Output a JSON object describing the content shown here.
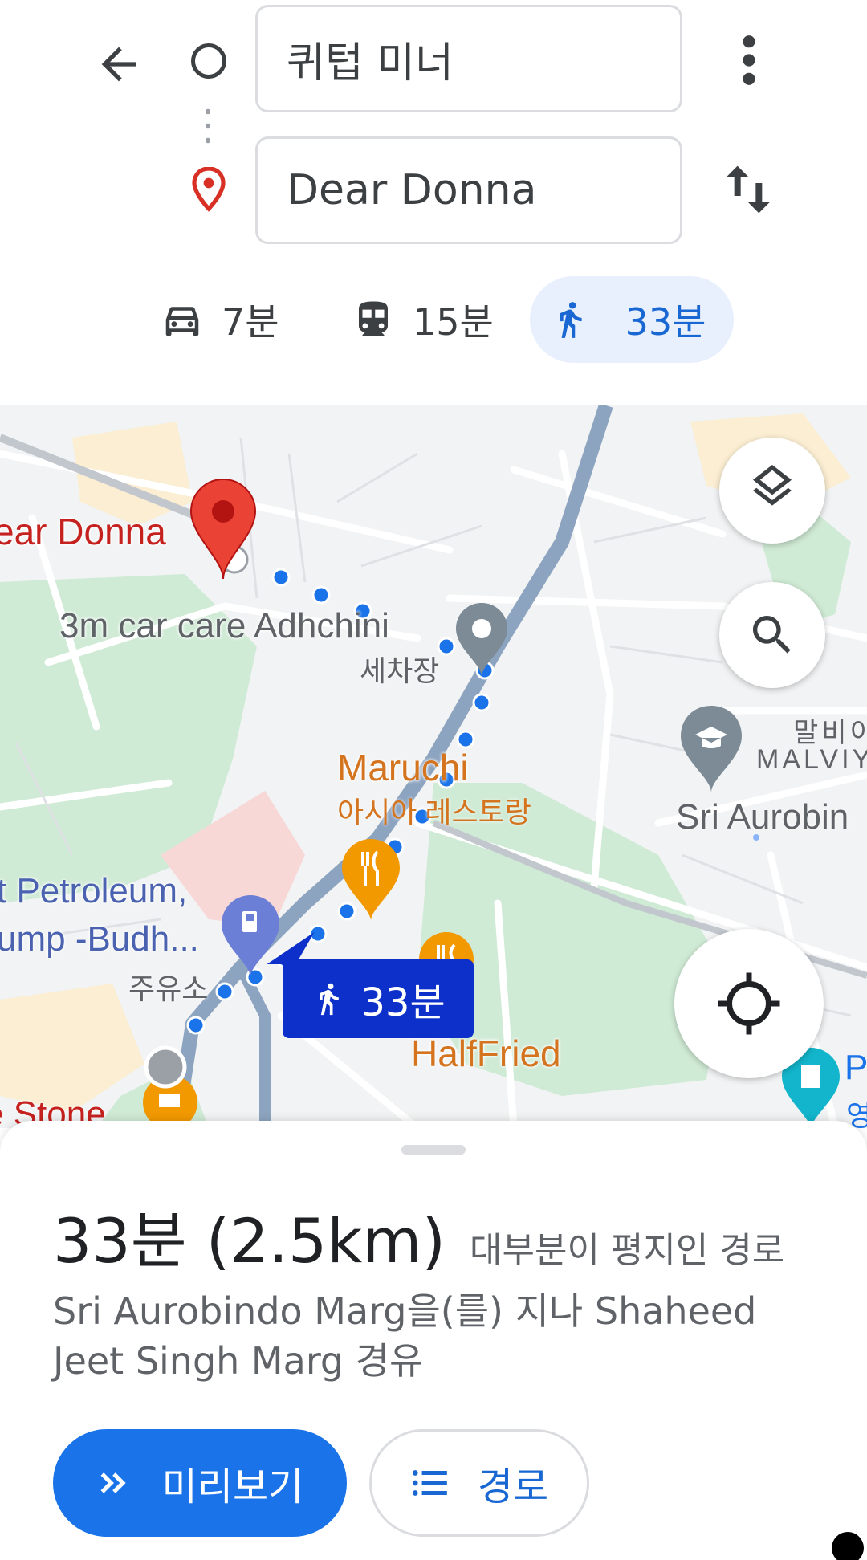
{
  "search": {
    "origin_value": "퀴텁 미너",
    "destination_value": "Dear Donna"
  },
  "modes": [
    {
      "icon": "car-icon",
      "label": "7분",
      "selected": false
    },
    {
      "icon": "train-icon",
      "label": "15분",
      "selected": false
    },
    {
      "icon": "walk-icon",
      "label": "33분",
      "selected": true
    }
  ],
  "map": {
    "labels": {
      "destination": "ear Donna",
      "carcare": "3m car care Adhchini",
      "carcare_sub": "세차장",
      "maruchi": "Maruchi",
      "maruchi_sub": "아시아 레스토랑",
      "petrol_line1": "t Petroleum,",
      "petrol_line2": "ump -Budh...",
      "petrol_sub": "주유소",
      "halffried": "HalfFried",
      "malviya1": "말비이",
      "malviya2": "MALVIY",
      "aurobindo": "Sri Aurobin",
      "stone": "e Stone",
      "p": "P",
      "p2": "영"
    },
    "route_chip": "33분",
    "route_color": "#1a73e8"
  },
  "sheet": {
    "duration": "33분 (2.5km)",
    "terrain": "대부분이 평지인 경로",
    "via": "Sri Aurobindo Marg을(를) 지나 Shaheed Jeet Singh Marg 경유",
    "preview_label": "미리보기",
    "steps_label": "경로"
  },
  "colors": {
    "accent": "#1a73e8",
    "selected_mode_bg": "#e8f0fe",
    "destination_pin": "#d93025"
  }
}
